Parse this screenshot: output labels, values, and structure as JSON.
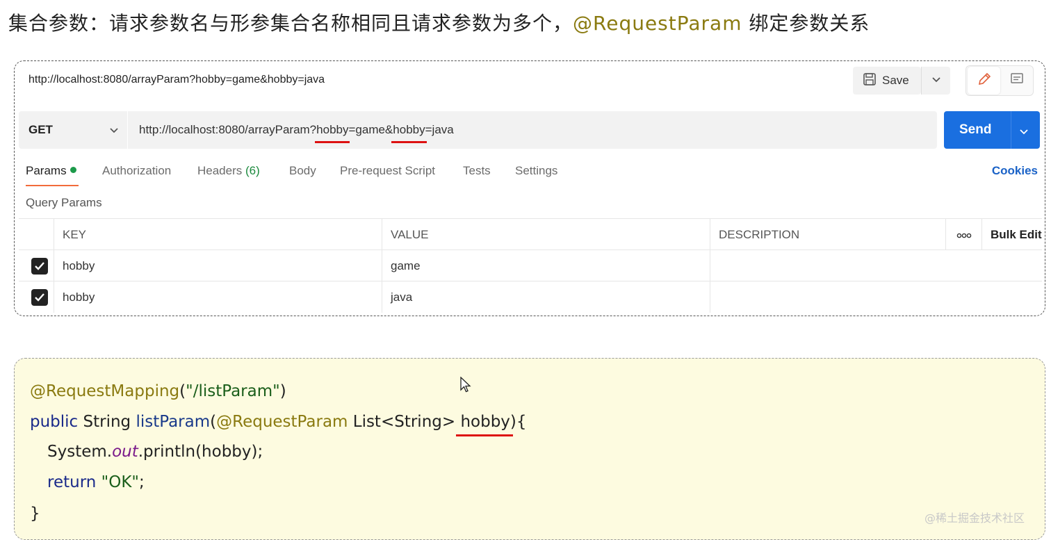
{
  "heading": {
    "prefix": "集合参数：请求参数名与形参集合名称相同且请求参数为多个，",
    "annotation": "@RequestParam",
    "suffix": " 绑定参数关系"
  },
  "postman": {
    "top_url": "http://localhost:8080/arrayParam?hobby=game&hobby=java",
    "save_label": "Save",
    "method": "GET",
    "url_parts": [
      "http://localhost:8080/arrayParam?",
      "hobby",
      "=game&",
      "hobby",
      "=java"
    ],
    "send_label": "Send",
    "tabs": [
      {
        "label": "Params",
        "active": true,
        "dot": true
      },
      {
        "label": "Authorization"
      },
      {
        "label": "Headers",
        "count": "(6)"
      },
      {
        "label": "Body"
      },
      {
        "label": "Pre-request Script"
      },
      {
        "label": "Tests"
      },
      {
        "label": "Settings"
      }
    ],
    "cookies_label": "Cookies",
    "query_params_label": "Query Params",
    "table": {
      "headers": {
        "key": "KEY",
        "value": "VALUE",
        "description": "DESCRIPTION",
        "more": "ooo",
        "bulk_edit": "Bulk Edit"
      },
      "rows": [
        {
          "checked": true,
          "key": "hobby",
          "value": "game",
          "description": ""
        },
        {
          "checked": true,
          "key": "hobby",
          "value": "java",
          "description": ""
        }
      ]
    }
  },
  "code": {
    "l1_anno": "@RequestMapping",
    "l1_open": "(",
    "l1_str": "\"/listParam\"",
    "l1_close": ")",
    "l2_public": "public",
    "l2_type": " String ",
    "l2_fn": "listParam",
    "l2_open": "(",
    "l2_anno": "@RequestParam",
    "l2_ptype": " List<String> ",
    "l2_param": "hobby",
    "l2_close": "){",
    "l3_sys": "System.",
    "l3_out": "out",
    "l3_rest": ".println(hobby);",
    "l4_return": "return",
    "l4_str": " \"OK\"",
    "l4_semi": ";",
    "l5": "}"
  },
  "watermark": "@稀土掘金技术社区",
  "colors": {
    "send": "#1a6fe0",
    "accent_tab": "#f26b3a",
    "code_bg": "#fdfbe0",
    "annotation": "#8a7a10",
    "underline": "#dd1111"
  }
}
